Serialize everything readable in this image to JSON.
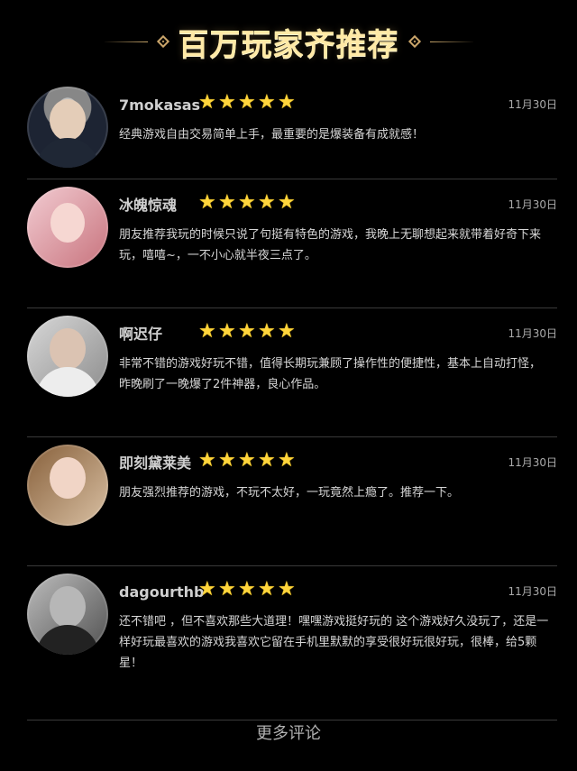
{
  "header": {
    "title": "百万玩家齐推荐"
  },
  "reviews": [
    {
      "name": "7mokasas",
      "date": "11月30日",
      "rating": 5,
      "comment": "经典游戏自由交易简单上手，最重要的是爆装备有成就感！"
    },
    {
      "name": "冰魄惊魂",
      "date": "11月30日",
      "rating": 5,
      "comment": "朋友推荐我玩的时候只说了句挺有特色的游戏，我晚上无聊想起来就带着好奇下来玩，嘻嘻~，一不小心就半夜三点了。"
    },
    {
      "name": "啊迟仔",
      "date": "11月30日",
      "rating": 5,
      "comment": "非常不错的游戏好玩不错，值得长期玩兼顾了操作性的便捷性，基本上自动打怪，昨晚刷了一晚爆了2件神器，良心作品。"
    },
    {
      "name": "即刻黛莱美",
      "date": "11月30日",
      "rating": 5,
      "comment": "朋友强烈推荐的游戏，不玩不太好，一玩竟然上瘾了。推荐一下。"
    },
    {
      "name": "dagourthb",
      "date": "11月30日",
      "rating": 5,
      "comment": "还不错吧 ，但不喜欢那些大道理！嘿嘿游戏挺好玩的 这个游戏好久没玩了，还是一样好玩最喜欢的游戏我喜欢它留在手机里默默的享受很好玩很好玩，很棒，给5颗星！"
    }
  ],
  "footer": {
    "more_label": "更多评论"
  },
  "colors": {
    "background": "#000000",
    "title": "#ffe9a6",
    "star": "#ffd53c",
    "divider": "#3a3a3a"
  },
  "icons": {
    "star": "star-icon",
    "header_decoration": "diamond-icon"
  }
}
